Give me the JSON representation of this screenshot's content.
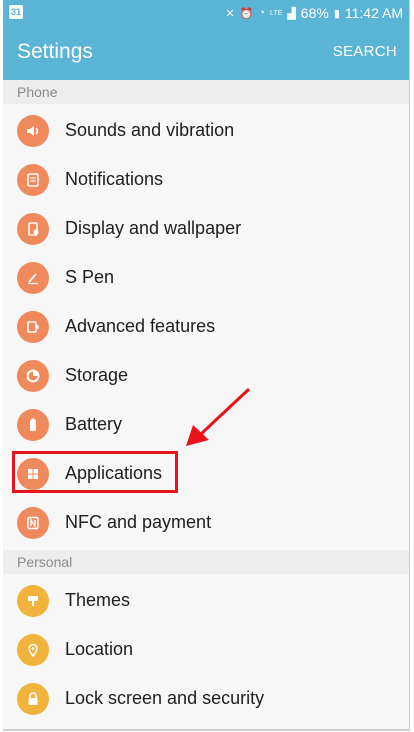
{
  "status_bar": {
    "calendar_badge": "31",
    "network_label": "LTE",
    "battery": "68%",
    "time": "11:42 AM"
  },
  "app_bar": {
    "title": "Settings",
    "search_label": "SEARCH"
  },
  "sections": [
    {
      "title": "Phone",
      "items": [
        {
          "label": "Sounds and vibration",
          "icon": "speaker-icon"
        },
        {
          "label": "Notifications",
          "icon": "notifications-icon"
        },
        {
          "label": "Display and wallpaper",
          "icon": "display-icon"
        },
        {
          "label": "S Pen",
          "icon": "pen-icon"
        },
        {
          "label": "Advanced features",
          "icon": "advanced-features-icon"
        },
        {
          "label": "Storage",
          "icon": "storage-icon"
        },
        {
          "label": "Battery",
          "icon": "battery-icon"
        },
        {
          "label": "Applications",
          "icon": "apps-grid-icon"
        },
        {
          "label": "NFC and payment",
          "icon": "nfc-icon"
        }
      ]
    },
    {
      "title": "Personal",
      "items": [
        {
          "label": "Themes",
          "icon": "brush-icon"
        },
        {
          "label": "Location",
          "icon": "location-pin-icon"
        },
        {
          "label": "Lock screen and security",
          "icon": "lock-icon"
        }
      ]
    }
  ],
  "colors": {
    "accent": "#5ab4d6",
    "phone_icon": "#f08a5c",
    "personal_icon": "#f2b33d",
    "annotation": "#e8141a"
  }
}
